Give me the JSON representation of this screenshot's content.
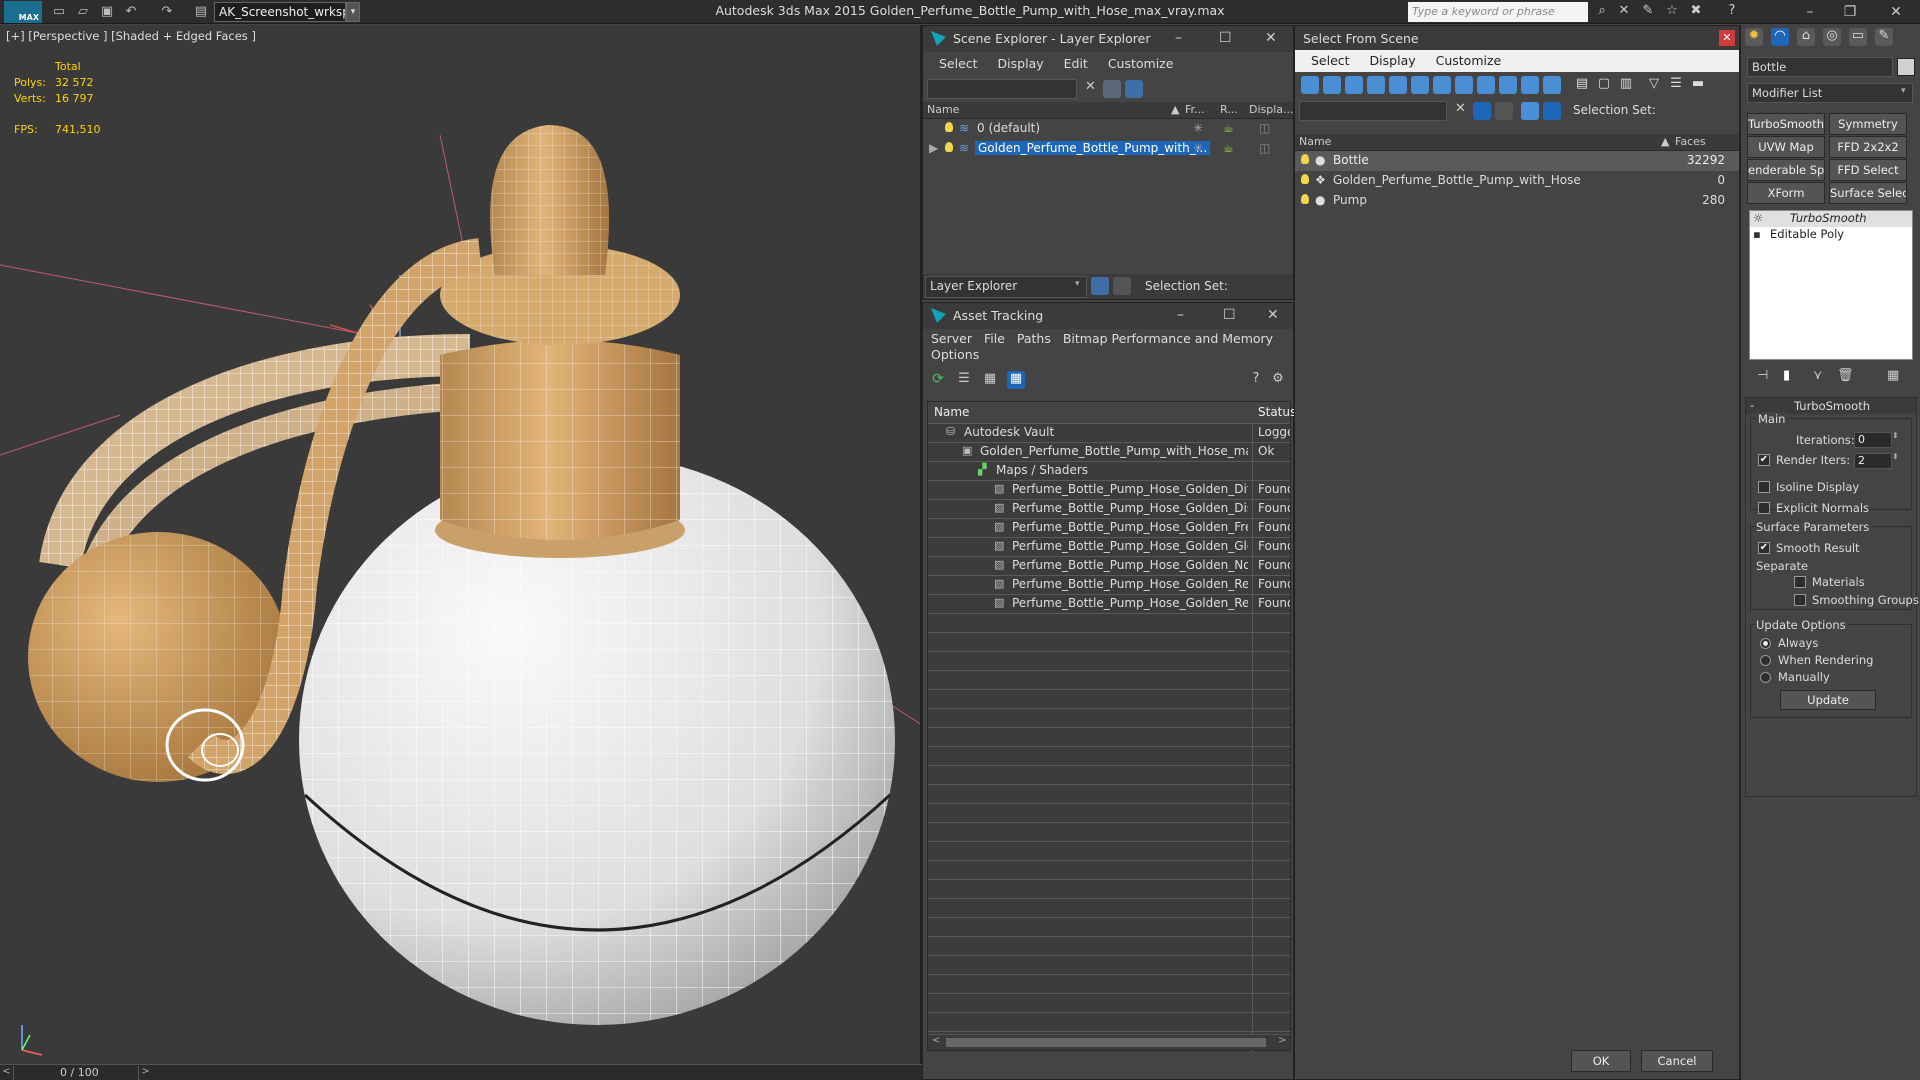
{
  "app": {
    "logo_label": "MAX",
    "workspace": "AK_Screenshot_wrksp",
    "title": "Autodesk 3ds Max  2015    Golden_Perfume_Bottle_Pump_with_Hose_max_vray.max",
    "keyword_placeholder": "Type a keyword or phrase"
  },
  "viewport": {
    "label": "[+] [Perspective ] [Shaded + Edged Faces ]",
    "stats": {
      "total_label": "Total",
      "polys_label": "Polys:",
      "polys_value": "32 572",
      "verts_label": "Verts:",
      "verts_value": "16 797",
      "fps_label": "FPS:",
      "fps_value": "741,510"
    },
    "timeline": "0 / 100"
  },
  "layer_explorer": {
    "title": "Scene Explorer - Layer Explorer",
    "menu": [
      "Select",
      "Display",
      "Edit",
      "Customize"
    ],
    "columns": [
      "Name",
      "Fr...",
      "R...",
      "Displa..."
    ],
    "rows": [
      {
        "name": "0 (default)",
        "selected": false
      },
      {
        "name": "Golden_Perfume_Bottle_Pump_with_...",
        "selected": true
      }
    ],
    "footer_dropdown": "Layer Explorer",
    "selection_set_label": "Selection Set:"
  },
  "asset_tracking": {
    "title": "Asset Tracking",
    "menu": [
      "Server",
      "File",
      "Paths",
      "Bitmap Performance and Memory",
      "Options"
    ],
    "columns": [
      "Name",
      "Status"
    ],
    "rows": [
      {
        "name": "Autodesk Vault",
        "status": "Logged",
        "indent": 0
      },
      {
        "name": "Golden_Perfume_Bottle_Pump_with_Hose_max_...",
        "status": "Ok",
        "indent": 1
      },
      {
        "name": "Maps / Shaders",
        "status": "",
        "indent": 2
      },
      {
        "name": "Perfume_Bottle_Pump_Hose_Golden_Diff...",
        "status": "Found",
        "indent": 3
      },
      {
        "name": "Perfume_Bottle_Pump_Hose_Golden_Disp...",
        "status": "Found",
        "indent": 3
      },
      {
        "name": "Perfume_Bottle_Pump_Hose_Golden_Fren...",
        "status": "Found",
        "indent": 3
      },
      {
        "name": "Perfume_Bottle_Pump_Hose_Golden_Glos...",
        "status": "Found",
        "indent": 3
      },
      {
        "name": "Perfume_Bottle_Pump_Hose_Golden_Nor...",
        "status": "Found",
        "indent": 3
      },
      {
        "name": "Perfume_Bottle_Pump_Hose_Golden_Refl...",
        "status": "Found",
        "indent": 3
      },
      {
        "name": "Perfume_Bottle_Pump_Hose_Golden_Refr...",
        "status": "Found",
        "indent": 3
      }
    ]
  },
  "select_from_scene": {
    "title": "Select From Scene",
    "menu": [
      "Select",
      "Display",
      "Customize"
    ],
    "selection_set_label": "Selection Set:",
    "columns": [
      "Name",
      "Faces"
    ],
    "rows": [
      {
        "name": "Bottle",
        "faces": "32292",
        "selected": true
      },
      {
        "name": "Golden_Perfume_Bottle_Pump_with_Hose",
        "faces": "0",
        "selected": false
      },
      {
        "name": "Pump",
        "faces": "280",
        "selected": false
      }
    ],
    "ok": "OK",
    "cancel": "Cancel"
  },
  "command_panel": {
    "object_name": "Bottle",
    "modifier_list": "Modifier List",
    "buttons": [
      "TurboSmooth",
      "Symmetry",
      "UVW Map",
      "FFD 2x2x2",
      "enderable Splin",
      "FFD Select",
      "XForm",
      "Surface Select"
    ],
    "stack": [
      "TurboSmooth",
      "Editable Poly"
    ],
    "rollout_title": "TurboSmooth",
    "main_label": "Main",
    "iterations_label": "Iterations:",
    "iterations_value": "0",
    "render_iters_label": "Render Iters:",
    "render_iters_value": "2",
    "isoline_label": "Isoline Display",
    "explicit_normals_label": "Explicit Normals",
    "surface_params_label": "Surface Parameters",
    "smooth_result_label": "Smooth Result",
    "separate_label": "Separate",
    "materials_label": "Materials",
    "smoothing_groups_label": "Smoothing Groups",
    "update_options_label": "Update Options",
    "always_label": "Always",
    "when_rendering_label": "When Rendering",
    "manually_label": "Manually",
    "update_button": "Update"
  },
  "colors": {
    "selection": "#1e66b8",
    "gold": "#d9a76a",
    "accent": "#13a3b8"
  }
}
